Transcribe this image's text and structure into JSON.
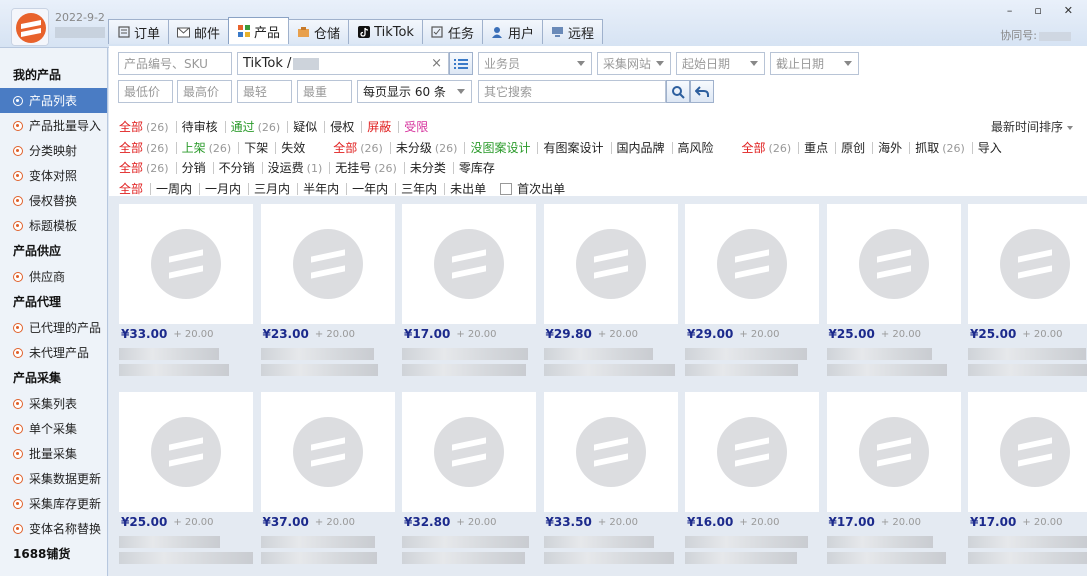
{
  "header": {
    "date": "2022-9-2",
    "assist_label": "协同号:",
    "tabs": [
      {
        "label": "订单",
        "icon": "order-icon"
      },
      {
        "label": "邮件",
        "icon": "mail-icon"
      },
      {
        "label": "产品",
        "icon": "product-grid-icon",
        "active": true
      },
      {
        "label": "仓储",
        "icon": "warehouse-icon"
      },
      {
        "label": "TikTok",
        "icon": "tiktok-icon"
      },
      {
        "label": "任务",
        "icon": "task-icon"
      },
      {
        "label": "用户",
        "icon": "user-icon"
      },
      {
        "label": "远程",
        "icon": "remote-icon"
      }
    ]
  },
  "sidebar": {
    "sections": [
      {
        "title": "我的产品",
        "items": [
          {
            "label": "产品列表",
            "selected": true
          },
          {
            "label": "产品批量导入"
          },
          {
            "label": "分类映射"
          },
          {
            "label": "变体对照"
          },
          {
            "label": "侵权替换"
          },
          {
            "label": "标题模板"
          }
        ]
      },
      {
        "title": "产品供应",
        "items": [
          {
            "label": "供应商"
          }
        ]
      },
      {
        "title": "产品代理",
        "items": [
          {
            "label": "已代理的产品"
          },
          {
            "label": "未代理产品"
          }
        ]
      },
      {
        "title": "产品采集",
        "items": [
          {
            "label": "采集列表"
          },
          {
            "label": "单个采集"
          },
          {
            "label": "批量采集"
          },
          {
            "label": "采集数据更新"
          },
          {
            "label": "采集库存更新"
          },
          {
            "label": "变体名称替换"
          }
        ]
      },
      {
        "title": "1688铺货",
        "items": []
      }
    ]
  },
  "filters": {
    "sku_placeholder": "产品编号、SKU",
    "store_value": "TikTok /",
    "clear": "×",
    "salesman": "业务员",
    "source_site": "采集网站",
    "start_date": "起始日期",
    "end_date": "截止日期",
    "min_price": "最低价",
    "max_price": "最高价",
    "lightest": "最轻",
    "heaviest": "最重",
    "page_size": "每页显示 60 条",
    "other_search": "其它搜索",
    "sort": "最新时间排序",
    "row1": [
      {
        "label": "全部",
        "count": "(26)",
        "color": "red"
      },
      {
        "label": "待审核"
      },
      {
        "label": "通过",
        "count": "(26)",
        "color": "green"
      },
      {
        "label": "疑似"
      },
      {
        "label": "侵权"
      },
      {
        "label": "屏蔽",
        "color": "red"
      },
      {
        "label": "受限",
        "color": "pink"
      }
    ],
    "row2a": [
      {
        "label": "全部",
        "count": "(26)",
        "color": "red"
      },
      {
        "label": "上架",
        "count": "(26)",
        "color": "green"
      },
      {
        "label": "下架"
      },
      {
        "label": "失效"
      }
    ],
    "row2b": [
      {
        "label": "全部",
        "count": "(26)",
        "color": "red"
      },
      {
        "label": "未分级",
        "count": "(26)"
      },
      {
        "label": "没图案设计",
        "color": "green"
      },
      {
        "label": "有图案设计"
      },
      {
        "label": "国内品牌"
      },
      {
        "label": "高风险"
      }
    ],
    "row2c": [
      {
        "label": "全部",
        "count": "(26)",
        "color": "red"
      },
      {
        "label": "重点"
      },
      {
        "label": "原创"
      },
      {
        "label": "海外"
      },
      {
        "label": "抓取",
        "count": "(26)"
      },
      {
        "label": "导入"
      }
    ],
    "row3": [
      {
        "label": "全部",
        "count": "(26)",
        "color": "red"
      },
      {
        "label": "分销"
      },
      {
        "label": "不分销"
      },
      {
        "label": "没运费",
        "count": "(1)"
      },
      {
        "label": "无挂号",
        "count": "(26)"
      },
      {
        "label": "未分类"
      },
      {
        "label": "零库存"
      }
    ],
    "row4": [
      {
        "label": "全部",
        "color": "red"
      },
      {
        "label": "一周内"
      },
      {
        "label": "一月内"
      },
      {
        "label": "三月内"
      },
      {
        "label": "半年内"
      },
      {
        "label": "一年内"
      },
      {
        "label": "三年内"
      },
      {
        "label": "未出单"
      }
    ],
    "first_order": "首次出单"
  },
  "products": [
    {
      "price": "¥33.00",
      "ship": "+ 20.00"
    },
    {
      "price": "¥23.00",
      "ship": "+ 20.00"
    },
    {
      "price": "¥17.00",
      "ship": "+ 20.00"
    },
    {
      "price": "¥29.80",
      "ship": "+ 20.00"
    },
    {
      "price": "¥29.00",
      "ship": "+ 20.00"
    },
    {
      "price": "¥25.00",
      "ship": "+ 20.00"
    },
    {
      "price": "¥25.00",
      "ship": "+ 20.00"
    },
    {
      "price": "¥25.00",
      "ship": "+ 20.00"
    },
    {
      "price": "¥37.00",
      "ship": "+ 20.00"
    },
    {
      "price": "¥32.80",
      "ship": "+ 20.00"
    },
    {
      "price": "¥33.50",
      "ship": "+ 20.00"
    },
    {
      "price": "¥16.00",
      "ship": "+ 20.00"
    },
    {
      "price": "¥17.00",
      "ship": "+ 20.00"
    },
    {
      "price": "¥17.00",
      "ship": "+ 20.00"
    }
  ],
  "colors": {
    "accent": "#4a7cc4",
    "price": "#1c2a8c",
    "red": "#e02020",
    "green": "#2a9a2a",
    "pink": "#d6309c"
  }
}
